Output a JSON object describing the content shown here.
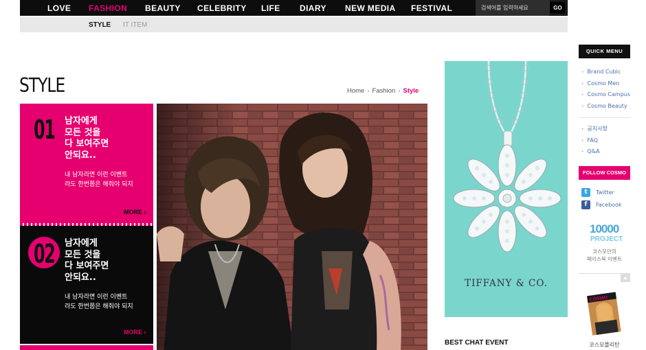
{
  "nav": {
    "items": [
      "LOVE",
      "FASHION",
      "BEAUTY",
      "CELEBRITY",
      "LIFE",
      "DIARY",
      "NEW MEDIA",
      "FESTIVAL"
    ],
    "active": "FASHION",
    "search_placeholder": "검색어를 입력하세요",
    "go_label": "GO"
  },
  "subnav": {
    "items": [
      "STYLE",
      "IT ITEM"
    ]
  },
  "page": {
    "title": "STYLE",
    "breadcrumb": [
      "Home",
      "Fashion",
      "Style"
    ]
  },
  "features": [
    {
      "number": "01",
      "headline": [
        "남자에게",
        "모든 것을",
        "다 보여주면",
        "안되요.."
      ],
      "desc": [
        "내 남자라면 이런 이벤트",
        "라도 한번쯤은 해줘야 되지"
      ],
      "more": "MORE"
    },
    {
      "number": "02",
      "headline": [
        "남자에게",
        "모든 것을",
        "다 보여주면",
        "안되요.."
      ],
      "desc": [
        "내 남자라면 이런 이벤트",
        "라도 한번쯤은 해줘야 되지"
      ],
      "more": "MORE"
    }
  ],
  "ad": {
    "brand": "TIFFANY & CO."
  },
  "best_chat": "BEST CHAT EVENT",
  "sidebar": {
    "quick_menu": "QUICK MENU",
    "links_group1": [
      "Brand Cubic",
      "Cosmo Men",
      "Cosmo Campus",
      "Cosmo Beauty"
    ],
    "links_group2": [
      "공지사항",
      "FAQ",
      "Q&A"
    ],
    "follow": "FOLLOW COSMO",
    "social": [
      {
        "icon": "twitter-icon",
        "label": "Twitter"
      },
      {
        "icon": "facebook-icon",
        "label": "Facebook"
      }
    ],
    "project_number": "10000",
    "project_label": "PROJECT",
    "project_sub": [
      "코스모만의",
      "페이스북 이벤트"
    ],
    "magazine_label": "코스모폴리탄"
  },
  "colors": {
    "accent": "#e6006f",
    "nav_bg": "#0d0d0d",
    "ad_bg": "#7ad5cd"
  }
}
